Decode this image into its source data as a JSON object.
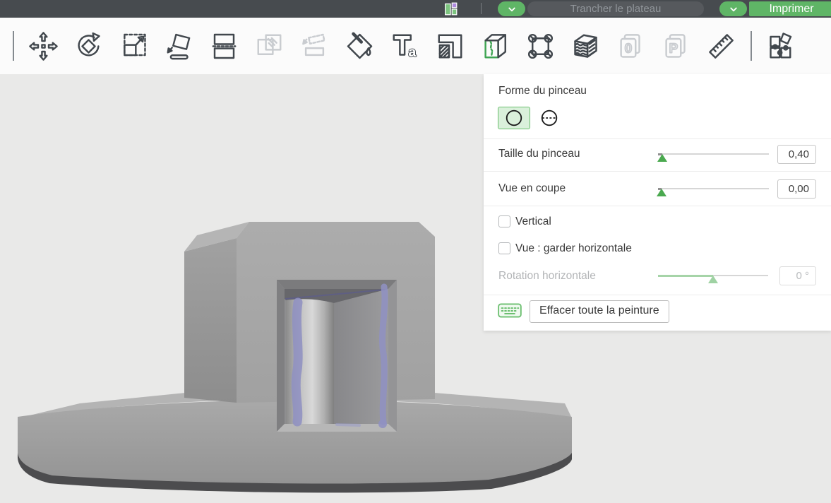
{
  "topbar": {
    "slice_button": "Trancher le plateau",
    "print_button": "Imprimer"
  },
  "toolbar": {
    "tools": [
      {
        "name": "separator"
      },
      {
        "name": "move",
        "state": "normal"
      },
      {
        "name": "rotate",
        "state": "normal"
      },
      {
        "name": "scale",
        "state": "normal"
      },
      {
        "name": "place-on-face",
        "state": "normal"
      },
      {
        "name": "cut",
        "state": "normal"
      },
      {
        "name": "mirror",
        "state": "disabled"
      },
      {
        "name": "lay-flat",
        "state": "disabled"
      },
      {
        "name": "paint",
        "state": "normal"
      },
      {
        "name": "text",
        "state": "normal"
      },
      {
        "name": "paint-supports",
        "state": "normal"
      },
      {
        "name": "seam-painting",
        "state": "selected"
      },
      {
        "name": "mmu-segmentation",
        "state": "normal"
      },
      {
        "name": "fuzzy-skin",
        "state": "normal"
      },
      {
        "name": "zero-layer",
        "state": "disabled"
      },
      {
        "name": "per-object-process",
        "state": "disabled"
      },
      {
        "name": "measure",
        "state": "normal"
      },
      {
        "name": "separator"
      },
      {
        "name": "assembly-view",
        "state": "normal"
      }
    ]
  },
  "gizmo_panel": {
    "brush_shape_label": "Forme du pinceau",
    "brush_size": {
      "label": "Taille du pinceau",
      "value": "0,40",
      "fill_pct": 4
    },
    "section_view": {
      "label": "Vue en coupe",
      "value": "0,00",
      "fill_pct": 3
    },
    "vertical_checkbox": {
      "label": "Vertical",
      "checked": false
    },
    "keep_horizontal_checkbox": {
      "label": "Vue : garder horizontale",
      "checked": false
    },
    "rotation": {
      "label": "Rotation horizontale",
      "value": "0 °",
      "fill_pct": 50,
      "disabled": true
    },
    "erase_button_label": "Effacer toute la peinture"
  },
  "colors": {
    "accent_green": "#5fb566",
    "topbar_bg": "#474b4f",
    "paint_purple": "#8f91c1",
    "viewport_bg": "#e9e9e8"
  }
}
